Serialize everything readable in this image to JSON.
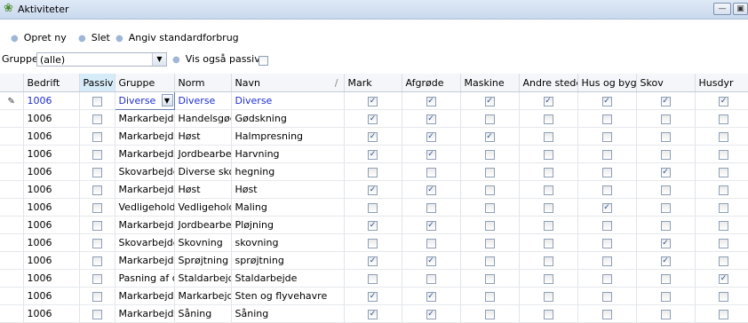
{
  "window": {
    "title": "Aktiviteter",
    "icon": "leaf-icon"
  },
  "toolbar": {
    "create_label": "Opret ny",
    "delete_label": "Slet",
    "default_usage_label": "Angiv standardforbrug"
  },
  "filter": {
    "group_label": "Gruppe",
    "group_value": "(alle)",
    "show_passive_label": "Vis også passive",
    "show_passive_checked": false
  },
  "columns": [
    "Bedrift",
    "Passiv",
    "Gruppe",
    "Norm",
    "Navn",
    "Mark",
    "Afgrøde",
    "Maskine",
    "Andre steder",
    "Hus og byg.",
    "Skov",
    "Husdyr"
  ],
  "sort_indicator": "/",
  "rows": [
    {
      "bedrift": "1006",
      "passiv": false,
      "gruppe": "Diverse",
      "norm": "Diverse",
      "navn": "Diverse",
      "flags": [
        true,
        true,
        true,
        true,
        true,
        true,
        true
      ],
      "active": true
    },
    {
      "bedrift": "1006",
      "passiv": false,
      "gruppe": "Markarbejde",
      "norm": "Handelsgødnin",
      "navn": "Gødskning",
      "flags": [
        true,
        true,
        false,
        false,
        false,
        false,
        false
      ]
    },
    {
      "bedrift": "1006",
      "passiv": false,
      "gruppe": "Markarbejde",
      "norm": "Høst",
      "navn": "Halmpresning",
      "flags": [
        true,
        true,
        true,
        false,
        false,
        false,
        false
      ]
    },
    {
      "bedrift": "1006",
      "passiv": false,
      "gruppe": "Markarbejde",
      "norm": "Jordbearbejdn",
      "navn": "Harvning",
      "flags": [
        true,
        true,
        false,
        false,
        false,
        false,
        false
      ]
    },
    {
      "bedrift": "1006",
      "passiv": false,
      "gruppe": "Skovarbejde",
      "norm": "Diverse skovar",
      "navn": "hegning",
      "flags": [
        false,
        false,
        false,
        false,
        false,
        true,
        false
      ]
    },
    {
      "bedrift": "1006",
      "passiv": false,
      "gruppe": "Markarbejde",
      "norm": "Høst",
      "navn": "Høst",
      "flags": [
        true,
        true,
        false,
        false,
        false,
        false,
        false
      ]
    },
    {
      "bedrift": "1006",
      "passiv": false,
      "gruppe": "Vedligehold",
      "norm": "Vedligehold",
      "navn": "Maling",
      "flags": [
        false,
        false,
        false,
        false,
        true,
        false,
        false
      ]
    },
    {
      "bedrift": "1006",
      "passiv": false,
      "gruppe": "Markarbejde",
      "norm": "Jordbearbejdn",
      "navn": "Pløjning",
      "flags": [
        true,
        true,
        false,
        false,
        false,
        false,
        false
      ]
    },
    {
      "bedrift": "1006",
      "passiv": false,
      "gruppe": "Skovarbejde",
      "norm": "Skovning",
      "navn": "skovning",
      "flags": [
        false,
        false,
        false,
        false,
        false,
        true,
        false
      ]
    },
    {
      "bedrift": "1006",
      "passiv": false,
      "gruppe": "Markarbejde",
      "norm": "Sprøjtning",
      "navn": "sprøjtning",
      "flags": [
        true,
        true,
        false,
        false,
        false,
        true,
        false
      ]
    },
    {
      "bedrift": "1006",
      "passiv": false,
      "gruppe": "Pasning af dyr",
      "norm": "Staldarbejde",
      "navn": "Staldarbejde",
      "flags": [
        false,
        false,
        false,
        false,
        false,
        false,
        true
      ]
    },
    {
      "bedrift": "1006",
      "passiv": false,
      "gruppe": "Markarbejde",
      "norm": "Markarbejde",
      "navn": "Sten og flyvehavre",
      "flags": [
        true,
        true,
        false,
        false,
        false,
        false,
        false
      ]
    },
    {
      "bedrift": "1006",
      "passiv": false,
      "gruppe": "Markarbejde",
      "norm": "Såning",
      "navn": "Såning",
      "flags": [
        true,
        true,
        false,
        false,
        false,
        false,
        false
      ]
    }
  ]
}
